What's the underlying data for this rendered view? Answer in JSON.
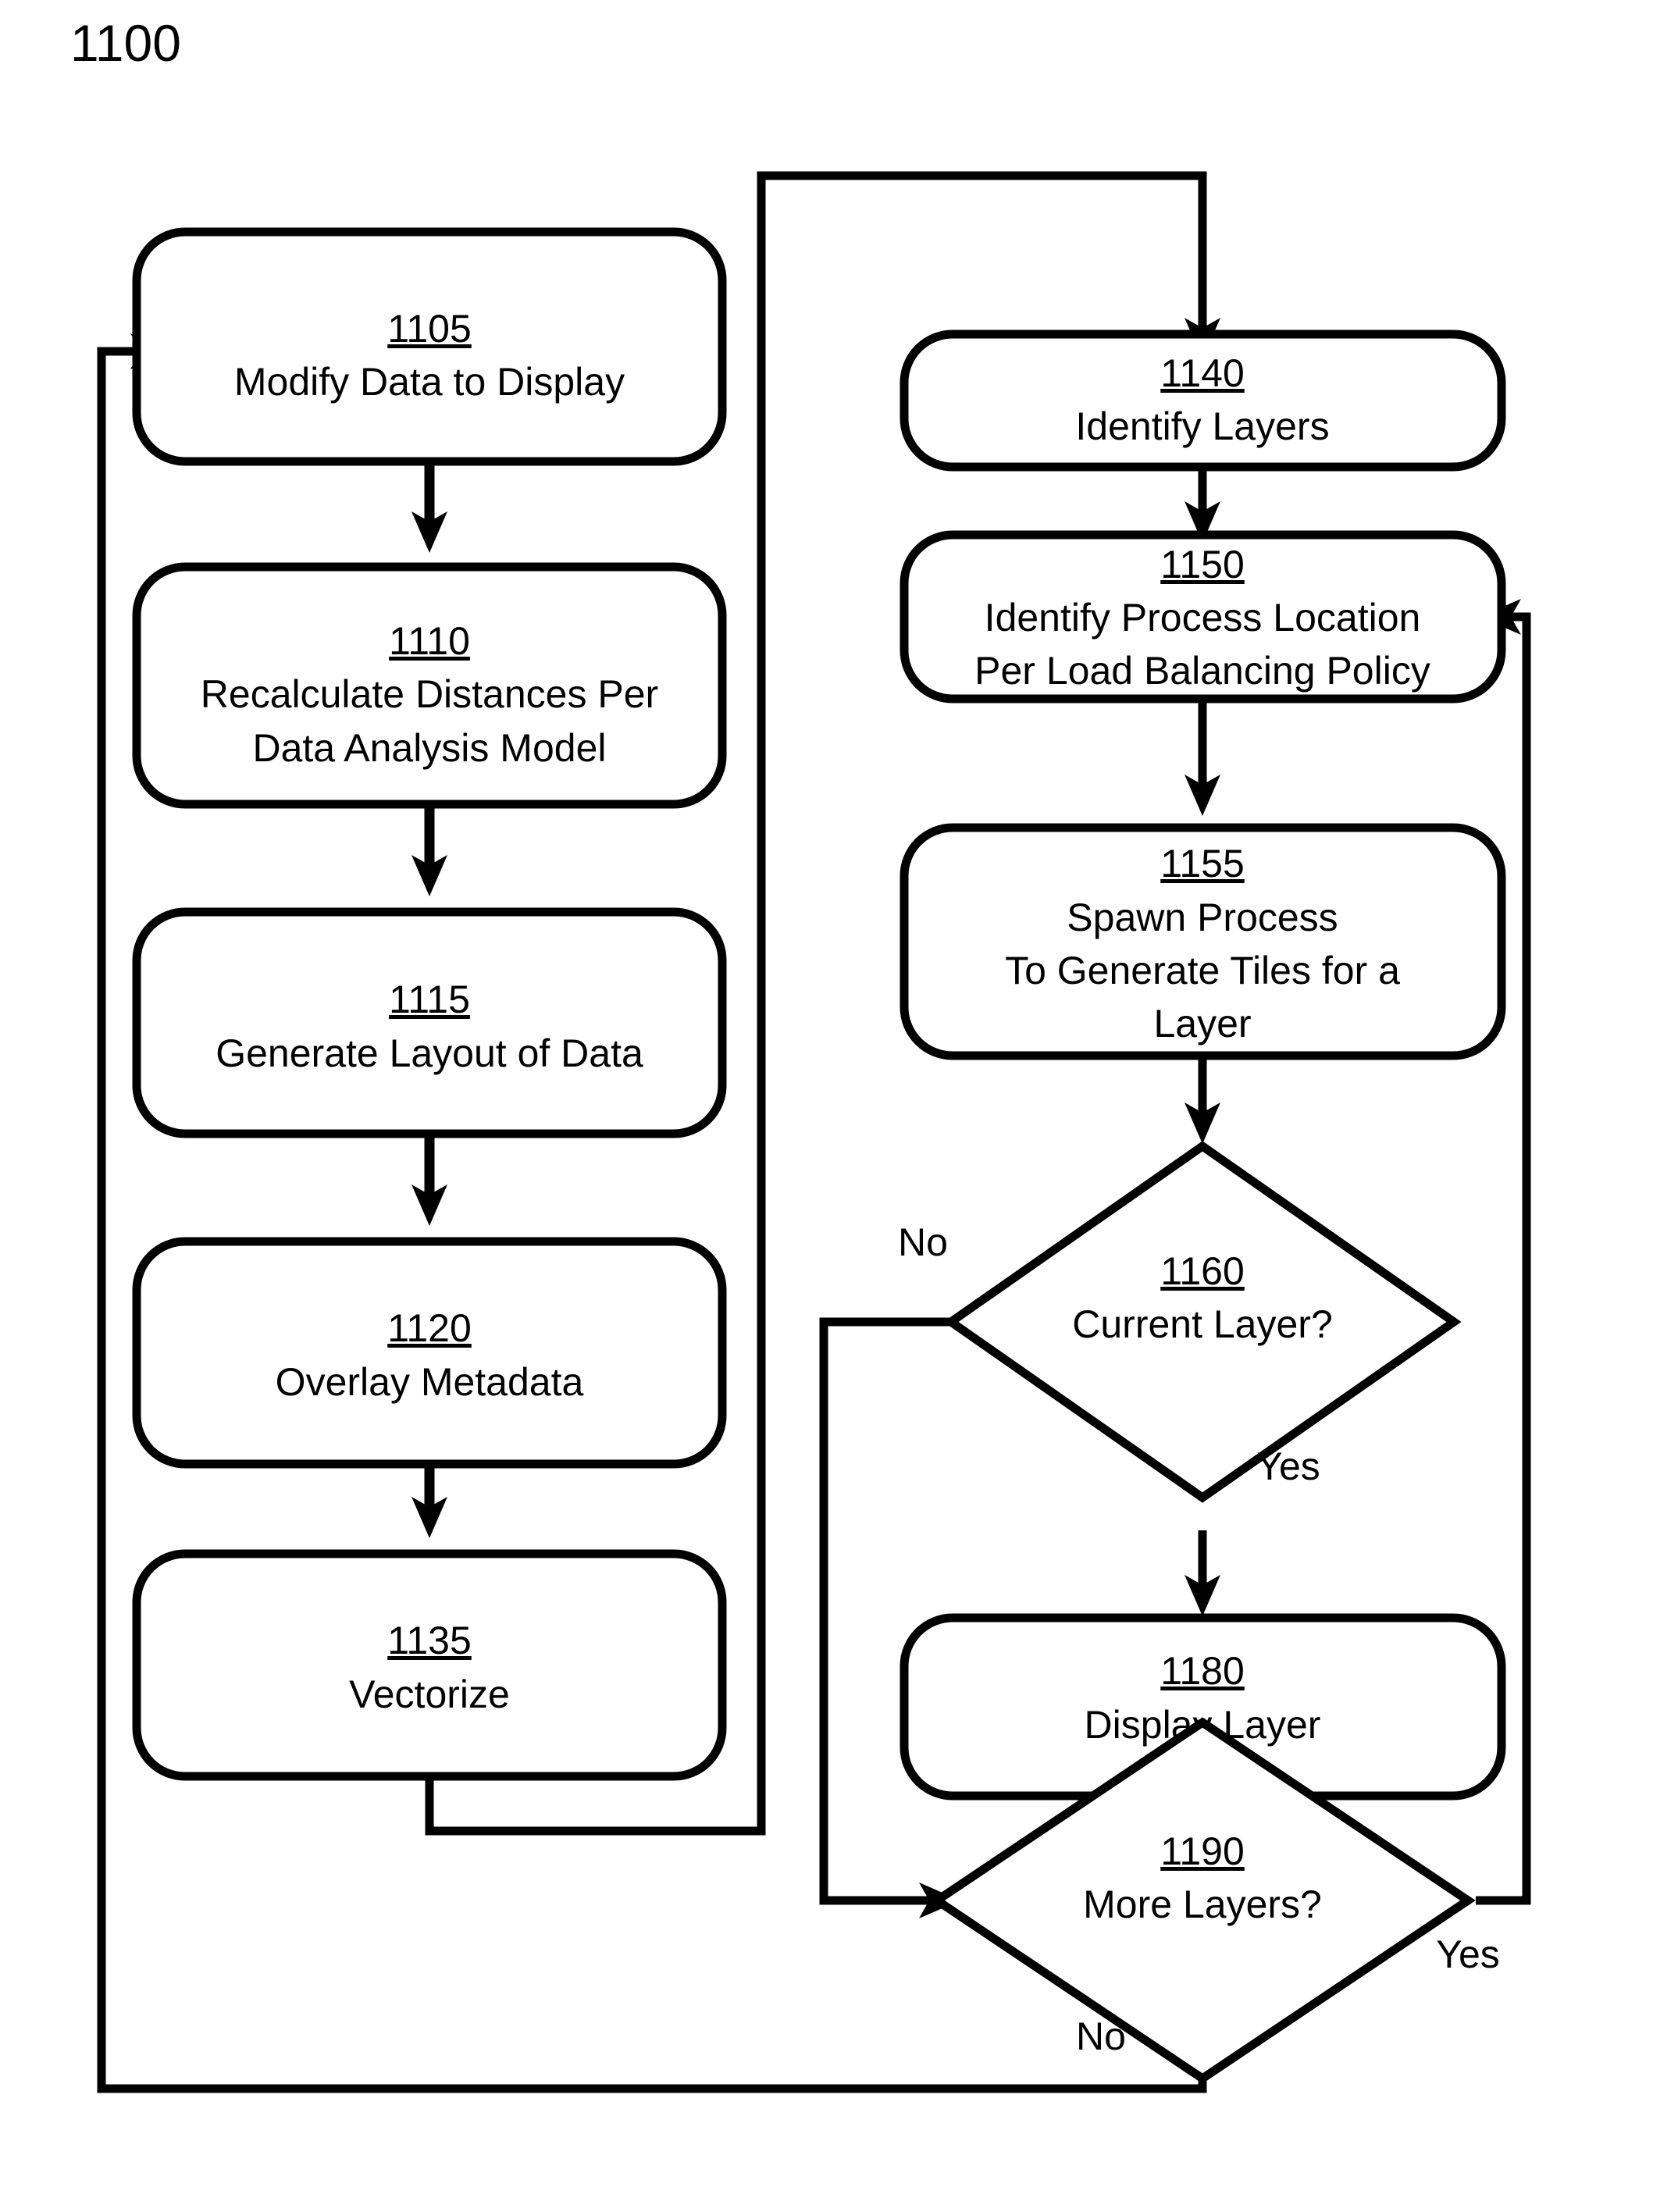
{
  "figure": {
    "label": "1100",
    "type": "process-flowchart"
  },
  "nodes": [
    {
      "id": "1105",
      "shape": "rounded-rect",
      "ref": "1105",
      "lines": [
        "Modify Data to Display"
      ]
    },
    {
      "id": "1110",
      "shape": "rounded-rect",
      "ref": "1110",
      "lines": [
        "Recalculate Distances Per",
        "Data Analysis Model"
      ]
    },
    {
      "id": "1115",
      "shape": "rounded-rect",
      "ref": "1115",
      "lines": [
        "Generate Layout of Data"
      ]
    },
    {
      "id": "1120",
      "shape": "rounded-rect",
      "ref": "1120",
      "lines": [
        "Overlay Metadata"
      ]
    },
    {
      "id": "1135",
      "shape": "rounded-rect",
      "ref": "1135",
      "lines": [
        "Vectorize"
      ]
    },
    {
      "id": "1140",
      "shape": "rounded-rect",
      "ref": "1140",
      "lines": [
        "Identify Layers"
      ]
    },
    {
      "id": "1150",
      "shape": "rounded-rect",
      "ref": "1150",
      "lines": [
        "Identify Process Location",
        "Per Load Balancing Policy"
      ]
    },
    {
      "id": "1155",
      "shape": "rounded-rect",
      "ref": "1155",
      "lines": [
        "Spawn Process",
        "To Generate Tiles for a",
        "Layer"
      ]
    },
    {
      "id": "1160",
      "shape": "diamond",
      "ref": "1160",
      "lines": [
        "Current Layer?"
      ]
    },
    {
      "id": "1180",
      "shape": "rounded-rect",
      "ref": "1180",
      "lines": [
        "Display Layer"
      ]
    },
    {
      "id": "1190",
      "shape": "diamond",
      "ref": "1190",
      "lines": [
        "More Layers?"
      ]
    }
  ],
  "edge_labels": {
    "decision_1160_no": "No",
    "decision_1160_yes": "Yes",
    "decision_1190_yes": "Yes",
    "decision_1190_no": "No"
  },
  "colors": {
    "stroke": "#000000",
    "fill": "#ffffff",
    "text": "#000000"
  }
}
